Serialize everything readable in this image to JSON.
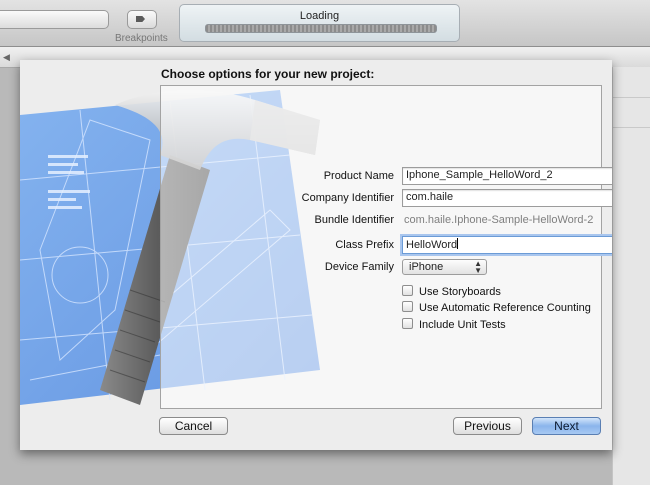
{
  "toolbar": {
    "breakpoints_label": "Breakpoints",
    "activity_text": "Loading"
  },
  "sheet": {
    "title": "Choose options for your new project:",
    "fields": {
      "product_name": {
        "label": "Product Name",
        "value": "Iphone_Sample_HelloWord_2"
      },
      "company_identifier": {
        "label": "Company Identifier",
        "value": "com.haile"
      },
      "bundle_identifier": {
        "label": "Bundle Identifier",
        "value": "com.haile.Iphone-Sample-HelloWord-2"
      },
      "class_prefix": {
        "label": "Class Prefix",
        "value": "HelloWord"
      },
      "device_family": {
        "label": "Device Family",
        "value": "iPhone"
      }
    },
    "options": [
      {
        "label": "Use Storyboards",
        "checked": false
      },
      {
        "label": "Use Automatic Reference Counting",
        "checked": false
      },
      {
        "label": "Include Unit Tests",
        "checked": false
      }
    ],
    "buttons": {
      "cancel": "Cancel",
      "previous": "Previous",
      "next": "Next"
    }
  },
  "colors": {
    "blueprint": "#6e9fe6",
    "default_button": "#8bb5ec",
    "focus_ring": "#a9c6ee"
  },
  "icons": {
    "breakpoints": "breakpoint-arrow-icon",
    "popup": "up-down-arrows-icon",
    "artwork": "hammer-blueprint-icon"
  }
}
